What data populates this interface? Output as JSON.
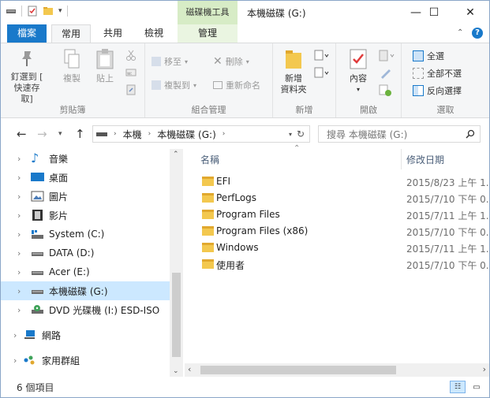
{
  "title": {
    "context_tab": "磁碟機工具",
    "window_title": "本機磁碟 (G:)"
  },
  "window_buttons": {
    "minimize": "—",
    "maximize": "☐",
    "close": "✕"
  },
  "tabs": {
    "file": "檔案",
    "home": "常用",
    "share": "共用",
    "view": "檢視",
    "manage": "管理"
  },
  "ribbon": {
    "clipboard": {
      "pin": "釘選到 [",
      "pin2": "快速存取]",
      "copy": "複製",
      "paste": "貼上",
      "label": "剪貼簿"
    },
    "organize": {
      "move_to": "移至",
      "copy_to": "複製到",
      "delete": "刪除",
      "rename": "重新命名",
      "label": "組合管理"
    },
    "new": {
      "new_folder": "新增",
      "new_folder2": "資料夾",
      "label": "新增"
    },
    "open": {
      "properties": "內容",
      "label": "開啟"
    },
    "select": {
      "select_all": "全選",
      "select_none": "全部不選",
      "invert": "反向選擇",
      "label": "選取"
    }
  },
  "address": {
    "crumbs": [
      "本機",
      "本機磁碟 (G:)"
    ],
    "search_placeholder": "搜尋 本機磁碟 (G:)"
  },
  "nav": {
    "items": [
      {
        "label": "音樂",
        "icon": "music-icon"
      },
      {
        "label": "桌面",
        "icon": "desktop-icon"
      },
      {
        "label": "圖片",
        "icon": "pictures-icon"
      },
      {
        "label": "影片",
        "icon": "videos-icon"
      },
      {
        "label": "System (C:)",
        "icon": "system-drive-icon"
      },
      {
        "label": "DATA (D:)",
        "icon": "drive-icon"
      },
      {
        "label": "Acer (E:)",
        "icon": "drive-icon"
      },
      {
        "label": "本機磁碟 (G:)",
        "icon": "drive-icon"
      },
      {
        "label": "DVD 光碟機 (I:) ESD-ISO",
        "icon": "dvd-drive-icon"
      },
      {
        "label": "網路",
        "icon": "network-icon"
      },
      {
        "label": "家用群組",
        "icon": "homegroup-icon"
      }
    ]
  },
  "content": {
    "columns": {
      "name": "名稱",
      "date": "修改日期"
    },
    "rows": [
      {
        "name": "EFI",
        "date": "2015/8/23 上午 1..."
      },
      {
        "name": "PerfLogs",
        "date": "2015/7/10 下午 0..."
      },
      {
        "name": "Program Files",
        "date": "2015/7/11 上午 1..."
      },
      {
        "name": "Program Files (x86)",
        "date": "2015/7/10 下午 0..."
      },
      {
        "name": "Windows",
        "date": "2015/7/11 上午 1..."
      },
      {
        "name": "使用者",
        "date": "2015/7/10 下午 0..."
      }
    ]
  },
  "status": {
    "count": "6 個項目"
  },
  "colors": {
    "accent": "#1979ca",
    "context_tab": "#d7ecc6",
    "selection": "#cce8ff",
    "folder": "#f3c84f"
  }
}
